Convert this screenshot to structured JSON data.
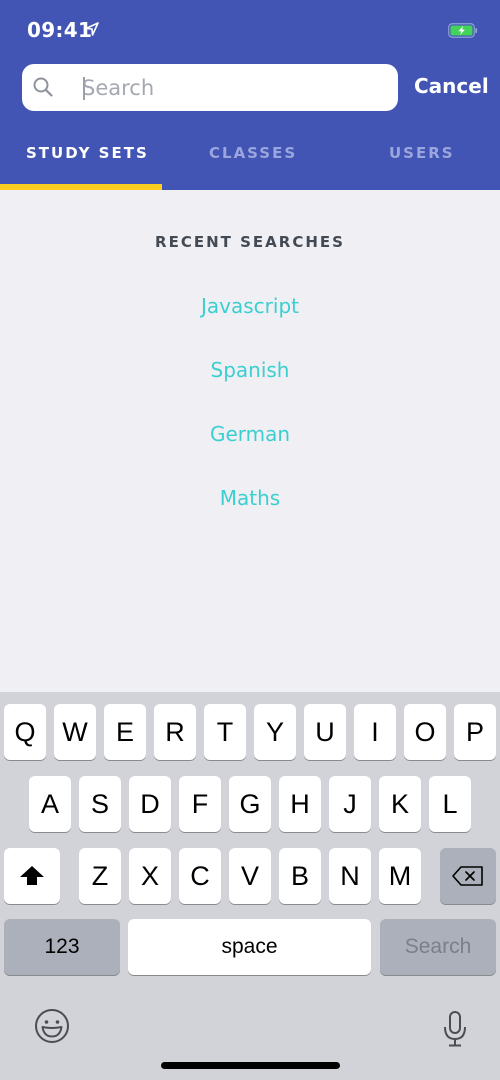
{
  "status_bar": {
    "time": "09:41",
    "location_icon": "location-arrow-icon",
    "battery_icon": "battery-charging-icon"
  },
  "search": {
    "placeholder": "Search",
    "value": "",
    "icon": "search-icon",
    "cancel_label": "Cancel"
  },
  "tabs": [
    {
      "label": "STUDY SETS",
      "active": true
    },
    {
      "label": "CLASSES",
      "active": false
    },
    {
      "label": "USERS",
      "active": false
    }
  ],
  "recent": {
    "title": "RECENT SEARCHES",
    "items": [
      "Javascript",
      "Spanish",
      "German",
      "Maths"
    ]
  },
  "keyboard": {
    "row1": [
      "Q",
      "W",
      "E",
      "R",
      "T",
      "Y",
      "U",
      "I",
      "O",
      "P"
    ],
    "row2": [
      "A",
      "S",
      "D",
      "F",
      "G",
      "H",
      "J",
      "K",
      "L"
    ],
    "row3": [
      "Z",
      "X",
      "C",
      "V",
      "B",
      "N",
      "M"
    ],
    "shift_icon": "shift-icon",
    "delete_icon": "backspace-icon",
    "numbers_label": "123",
    "space_label": "space",
    "action_label": "Search",
    "emoji_icon": "emoji-icon",
    "mic_icon": "microphone-icon"
  },
  "colors": {
    "header_bg": "#4255b4",
    "tab_indicator": "#ffcd1f",
    "recent_item": "#3ccfcf",
    "page_bg": "#efeff4",
    "keyboard_bg": "#d1d3d9"
  }
}
